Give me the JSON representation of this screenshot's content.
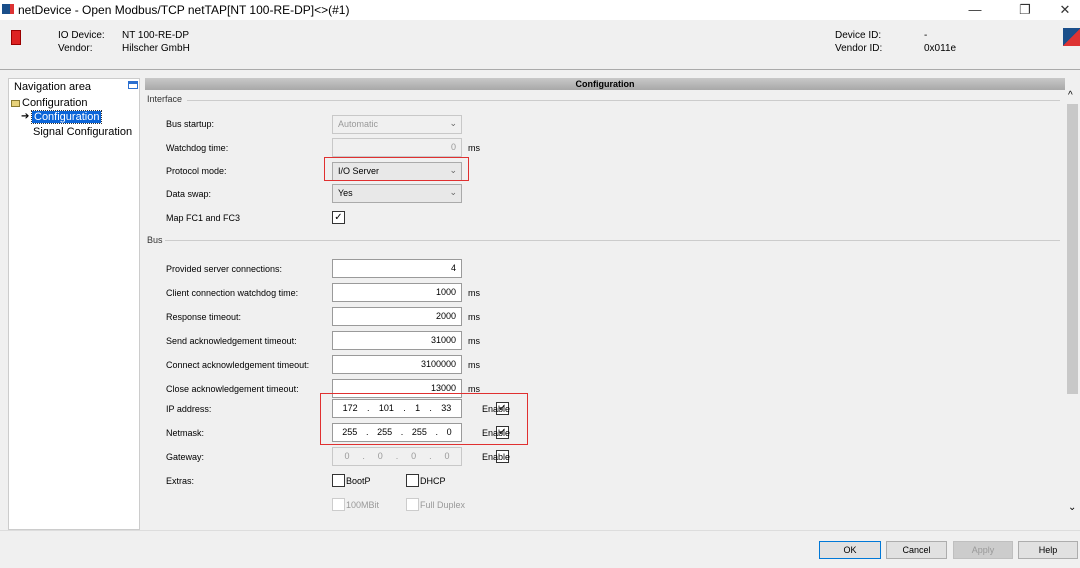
{
  "window": {
    "title": "netDevice - Open Modbus/TCP netTAP[NT 100-RE-DP]<>(#1)",
    "minimize": "—",
    "restore": "❐",
    "close": "✕"
  },
  "header": {
    "io_device_label": "IO Device:",
    "io_device": "NT 100-RE-DP",
    "vendor_label": "Vendor:",
    "vendor": "Hilscher GmbH",
    "device_id_label": "Device ID:",
    "device_id": "-",
    "vendor_id_label": "Vendor ID:",
    "vendor_id": "0x011e"
  },
  "nav": {
    "title": "Navigation area",
    "root": "Configuration",
    "items": [
      "Configuration",
      "Signal Configuration"
    ],
    "selected": "Configuration"
  },
  "config": {
    "title": "Configuration",
    "interface": {
      "label": "Interface",
      "bus_startup": {
        "label": "Bus startup:",
        "value": "Automatic"
      },
      "watchdog": {
        "label": "Watchdog time:",
        "value": "0",
        "unit": "ms"
      },
      "protocol_mode": {
        "label": "Protocol mode:",
        "value": "I/O Server"
      },
      "data_swap": {
        "label": "Data swap:",
        "value": "Yes"
      },
      "map_fc": {
        "label": "Map FC1 and FC3",
        "checked": true
      }
    },
    "bus": {
      "label": "Bus",
      "fields": [
        {
          "label": "Provided server connections:",
          "value": "4",
          "unit": ""
        },
        {
          "label": "Client connection watchdog time:",
          "value": "1000",
          "unit": "ms"
        },
        {
          "label": "Response timeout:",
          "value": "2000",
          "unit": "ms"
        },
        {
          "label": "Send acknowledgement timeout:",
          "value": "31000",
          "unit": "ms"
        },
        {
          "label": "Connect acknowledgement timeout:",
          "value": "3100000",
          "unit": "ms"
        },
        {
          "label": "Close acknowledgement timeout:",
          "value": "13000",
          "unit": "ms"
        }
      ],
      "ip": {
        "label": "IP address:",
        "octets": [
          "172",
          "101",
          "1",
          "33"
        ],
        "enable": "Enable",
        "checked": true
      },
      "netmask": {
        "label": "Netmask:",
        "octets": [
          "255",
          "255",
          "255",
          "0"
        ],
        "enable": "Enable",
        "checked": true
      },
      "gateway": {
        "label": "Gateway:",
        "octets": [
          "0",
          "0",
          "0",
          "0"
        ],
        "enable": "Enable",
        "checked": false
      },
      "extras": {
        "label": "Extras:",
        "bootp": "BootP",
        "dhcp": "DHCP",
        "mbit": "100MBit",
        "duplex": "Full Duplex"
      }
    }
  },
  "buttons": {
    "ok": "OK",
    "cancel": "Cancel",
    "apply": "Apply",
    "help": "Help"
  }
}
